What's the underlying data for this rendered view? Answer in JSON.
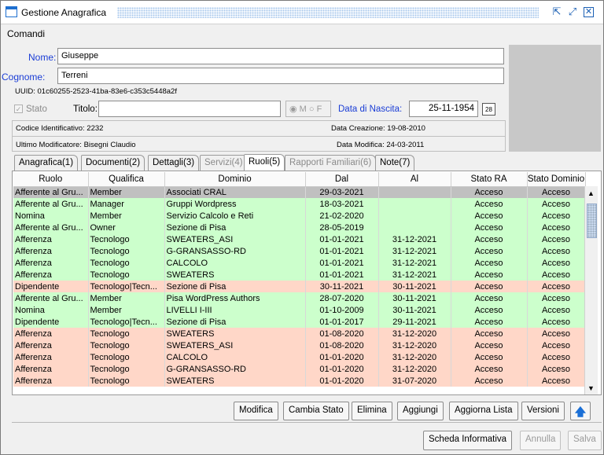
{
  "window": {
    "title": "Gestione Anagrafica",
    "app_icon": "window-icon"
  },
  "menu": {
    "items": [
      "Comandi"
    ]
  },
  "header": {
    "nome_label": "Nome:",
    "nome_value": "Giuseppe",
    "cognome_label": "Cognome:",
    "cognome_value": "Terreni",
    "uuid_text": "UUID: 01c60255-2523-41ba-83e6-c353c5448a2f",
    "stato_label": "Stato",
    "titolo_label": "Titolo:",
    "titolo_value": "",
    "gender_m": "M",
    "gender_f": "F",
    "nascita_label": "Data di Nascita:",
    "nascita_value": "25-11-1954",
    "codice_text": "Codice Identificativo:  2232",
    "creazione_text": "Data Creazione:  19-08-2010",
    "modificatore_text": "Ultimo Modificatore:   Bisegni Claudio",
    "modifica_text": "Data Modifica:  24-03-2011"
  },
  "tabs": [
    {
      "label": "Anagrafica(1)",
      "state": "normal"
    },
    {
      "label": "Documenti(2)",
      "state": "normal"
    },
    {
      "label": "Dettagli(3)",
      "state": "normal"
    },
    {
      "label": "Servizi(4)",
      "state": "disabled"
    },
    {
      "label": "Ruoli(5)",
      "state": "active"
    },
    {
      "label": "Rapporti Familiari(6)",
      "state": "disabled"
    },
    {
      "label": "Note(7)",
      "state": "normal"
    }
  ],
  "grid": {
    "columns": [
      "Ruolo",
      "Qualifica",
      "Dominio",
      "Dal",
      "Al",
      "Stato RA",
      "Stato Dominio"
    ],
    "colors": {
      "gray": "#c0c0c0",
      "green": "#ccffcc",
      "orange": "#ffd7c8"
    },
    "rows": [
      {
        "color": "gray",
        "cells": [
          "Afferente al Gru...",
          "Member",
          "Associati CRAL",
          "29-03-2021",
          "",
          "Acceso",
          "Acceso"
        ]
      },
      {
        "color": "green",
        "cells": [
          "Afferente al Gru...",
          "Manager",
          "Gruppi Wordpress",
          "18-03-2021",
          "",
          "Acceso",
          "Acceso"
        ]
      },
      {
        "color": "green",
        "cells": [
          "Nomina",
          "Member",
          "Servizio Calcolo e Reti",
          "21-02-2020",
          "",
          "Acceso",
          "Acceso"
        ]
      },
      {
        "color": "green",
        "cells": [
          "Afferente al Gru...",
          "Owner",
          "Sezione di Pisa",
          "28-05-2019",
          "",
          "Acceso",
          "Acceso"
        ]
      },
      {
        "color": "green",
        "cells": [
          "Afferenza",
          "Tecnologo",
          "SWEATERS_ASI",
          "01-01-2021",
          "31-12-2021",
          "Acceso",
          "Acceso"
        ]
      },
      {
        "color": "green",
        "cells": [
          "Afferenza",
          "Tecnologo",
          "G-GRANSASSO-RD",
          "01-01-2021",
          "31-12-2021",
          "Acceso",
          "Acceso"
        ]
      },
      {
        "color": "green",
        "cells": [
          "Afferenza",
          "Tecnologo",
          "CALCOLO",
          "01-01-2021",
          "31-12-2021",
          "Acceso",
          "Acceso"
        ]
      },
      {
        "color": "green",
        "cells": [
          "Afferenza",
          "Tecnologo",
          "SWEATERS",
          "01-01-2021",
          "31-12-2021",
          "Acceso",
          "Acceso"
        ]
      },
      {
        "color": "orange",
        "cells": [
          "Dipendente",
          "Tecnologo|Tecn...",
          "Sezione di Pisa",
          "30-11-2021",
          "30-11-2021",
          "Acceso",
          "Acceso"
        ]
      },
      {
        "color": "green",
        "cells": [
          "Afferente al Gru...",
          "Member",
          "Pisa WordPress Authors",
          "28-07-2020",
          "30-11-2021",
          "Acceso",
          "Acceso"
        ]
      },
      {
        "color": "green",
        "cells": [
          "Nomina",
          "Member",
          "LIVELLI I-III",
          "01-10-2009",
          "30-11-2021",
          "Acceso",
          "Acceso"
        ]
      },
      {
        "color": "green",
        "cells": [
          "Dipendente",
          "Tecnologo|Tecn...",
          "Sezione di Pisa",
          "01-01-2017",
          "29-11-2021",
          "Acceso",
          "Acceso"
        ]
      },
      {
        "color": "orange",
        "cells": [
          "Afferenza",
          "Tecnologo",
          "SWEATERS",
          "01-08-2020",
          "31-12-2020",
          "Acceso",
          "Acceso"
        ]
      },
      {
        "color": "orange",
        "cells": [
          "Afferenza",
          "Tecnologo",
          "SWEATERS_ASI",
          "01-08-2020",
          "31-12-2020",
          "Acceso",
          "Acceso"
        ]
      },
      {
        "color": "orange",
        "cells": [
          "Afferenza",
          "Tecnologo",
          "CALCOLO",
          "01-01-2020",
          "31-12-2020",
          "Acceso",
          "Acceso"
        ]
      },
      {
        "color": "orange",
        "cells": [
          "Afferenza",
          "Tecnologo",
          "G-GRANSASSO-RD",
          "01-01-2020",
          "31-12-2020",
          "Acceso",
          "Acceso"
        ]
      },
      {
        "color": "orange",
        "cells": [
          "Afferenza",
          "Tecnologo",
          "SWEATERS",
          "01-01-2020",
          "31-07-2020",
          "Acceso",
          "Acceso"
        ]
      }
    ]
  },
  "actions": {
    "modifica": "Modifica",
    "cambia_stato": "Cambia Stato",
    "elimina": "Elimina",
    "aggiungi": "Aggiungi",
    "aggiorna": "Aggiorna Lista",
    "versioni": "Versioni"
  },
  "footer": {
    "scheda": "Scheda Informativa",
    "annulla": "Annulla",
    "salva": "Salva"
  }
}
